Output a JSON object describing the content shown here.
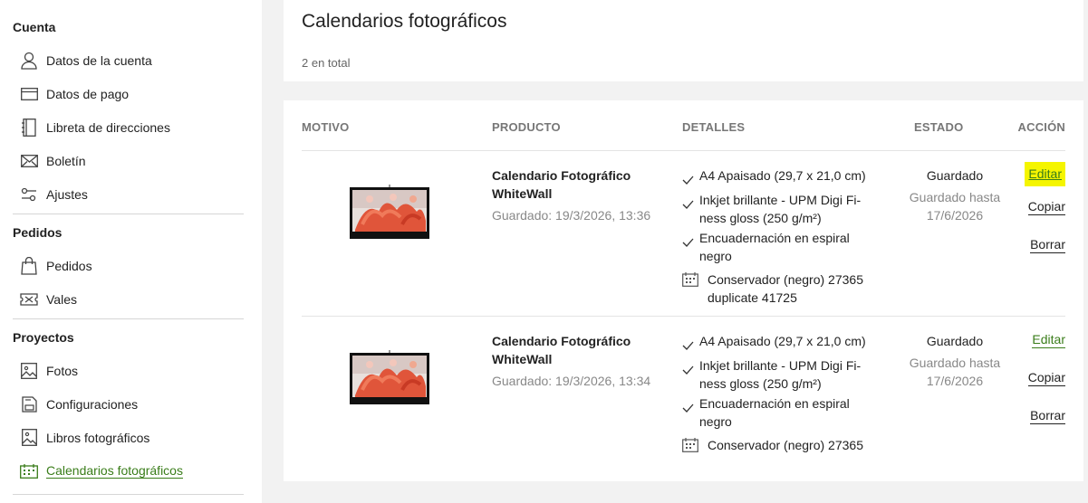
{
  "sidebar": {
    "sections": [
      {
        "title": "Cuenta",
        "items": [
          {
            "label": "Datos de la cuenta",
            "icon": "user-icon"
          },
          {
            "label": "Datos de pago",
            "icon": "card-icon"
          },
          {
            "label": "Libreta de direcciones",
            "icon": "address-book-icon"
          },
          {
            "label": "Boletín",
            "icon": "envelope-icon"
          },
          {
            "label": "Ajustes",
            "icon": "sliders-icon"
          }
        ]
      },
      {
        "title": "Pedidos",
        "items": [
          {
            "label": "Pedidos",
            "icon": "bag-icon"
          },
          {
            "label": "Vales",
            "icon": "ticket-icon"
          }
        ]
      },
      {
        "title": "Proyectos",
        "items": [
          {
            "label": "Fotos",
            "icon": "photo-icon"
          },
          {
            "label": "Configuraciones",
            "icon": "save-icon"
          },
          {
            "label": "Libros fotográficos",
            "icon": "photobook-icon"
          },
          {
            "label": "Calendarios fotográficos",
            "icon": "calendar-icon",
            "active": true
          }
        ]
      }
    ]
  },
  "main": {
    "title": "Calendarios fotográficos",
    "total": "2 en total",
    "columns": [
      "MOTIVO",
      "PRODUCTO",
      "DETALLES",
      "ESTADO",
      "ACCIÓN"
    ],
    "rows": [
      {
        "name": "Calendario Fotográfico WhiteWall",
        "saved": "Guardado: 19/3/2026, 13:36",
        "details": [
          "A4 Apaisado (29,7 x 21,0 cm)",
          "Inkjet brillante - UPM Digi Fi-ness gloss (250 g/m²)",
          "Encuadernación en espiral negro"
        ],
        "extra": "Conservador (negro) 27365 duplicate 41725",
        "status": "Guardado",
        "status_until": "Guardado hasta 17/6/2026",
        "actions": [
          "Editar",
          "Copiar",
          "Borrar"
        ]
      },
      {
        "name": "Calendario Fotográfico WhiteWall",
        "saved": "Guardado: 19/3/2026, 13:34",
        "details": [
          "A4 Apaisado (29,7 x 21,0 cm)",
          "Inkjet brillante - UPM Digi Fi-ness gloss (250 g/m²)",
          "Encuadernación en espiral negro"
        ],
        "extra": "Conservador (negro) 27365",
        "status": "Guardado",
        "status_until": "Guardado hasta 17/6/2026",
        "actions": [
          "Editar",
          "Copiar",
          "Borrar"
        ]
      }
    ]
  },
  "colors": {
    "accent": "#3a7d1a",
    "highlight": "#f5f500"
  }
}
